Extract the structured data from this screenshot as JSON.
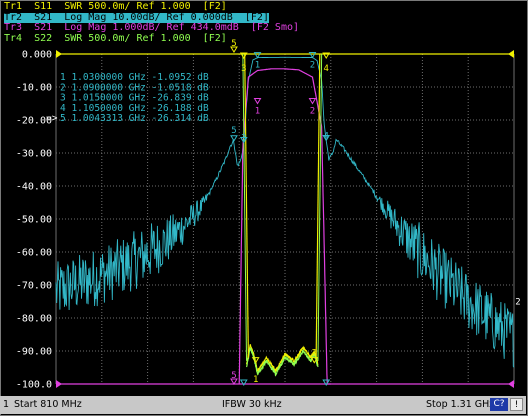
{
  "traces": [
    {
      "text": "Tr1  S11  SWR 500.0m/ Ref 1.000  [F2]",
      "color": "#f0f000",
      "active": false
    },
    {
      "text": "Tr2  S21  Log Mag 10.00dB/ Ref 0.000dB  [F2]",
      "color": "#32b8c8",
      "active": true
    },
    {
      "text": "Tr3  S21  Log Mag 1.000dB/ Ref 434.0mdB  [F2 Smo]",
      "color": "#e040e0",
      "active": false
    },
    {
      "text": "Tr4  S22  SWR 500.0m/ Ref 1.000  [F2]",
      "color": "#90ff50",
      "active": false
    }
  ],
  "markers": [
    {
      "num": "1",
      "freq": "1.0300000 GHz",
      "value": "-1.0952 dB",
      "active": false
    },
    {
      "num": "2",
      "freq": "1.0900000 GHz",
      "value": "-1.0518 dB",
      "active": false
    },
    {
      "num": "3",
      "freq": "1.0150000 GHz",
      "value": "-26.839  dB",
      "active": false
    },
    {
      "num": "4",
      "freq": "1.1050000 GHz",
      "value": "-26.188  dB",
      "active": false
    },
    {
      "num": "5",
      "freq": "1.0043313 GHz",
      "value": "-26.314  dB",
      "active": true
    }
  ],
  "ref_marker": "=>",
  "status": {
    "channel": "1",
    "start": "Start 810 MHz",
    "ifbw": "IFBW 30 kHz",
    "stop": "Stop 1.31 GHz",
    "c2": "C?",
    "q": "!"
  },
  "colors": {
    "tr1": "#f0f000",
    "tr2": "#32b8c8",
    "tr3": "#e040e0",
    "tr4": "#90ff50",
    "grid": "#6e6e6e",
    "axis_labels": "#ffffff"
  },
  "chart_data": {
    "type": "line",
    "title": "",
    "xlabel": "",
    "ylabel": "",
    "x_range_mhz": [
      810,
      1310
    ],
    "ylim": [
      -100,
      0
    ],
    "y_ticks": [
      0,
      -10,
      -20,
      -30,
      -40,
      -50,
      -60,
      -70,
      -80,
      -90,
      -100
    ],
    "y_tick_labels": [
      "0.000",
      "-10.00",
      "-20.00",
      "-30.00",
      "-40.00",
      "-50.00",
      "-60.00",
      "-70.00",
      "-80.00",
      "-90.00",
      "-100.0"
    ],
    "grid": true,
    "series": [
      {
        "name": "Tr2 S21 Log Mag",
        "color": "#32b8c8",
        "x": [
          810,
          840,
          870,
          900,
          930,
          950,
          970,
          985,
          995,
          1000,
          1004,
          1008,
          1012,
          1015,
          1020,
          1025,
          1030,
          1040,
          1060,
          1080,
          1090,
          1095,
          1100,
          1103,
          1105,
          1108,
          1112,
          1116,
          1125,
          1140,
          1160,
          1180,
          1200,
          1230,
          1260,
          1290,
          1310
        ],
        "y": [
          -72,
          -69,
          -66,
          -62,
          -57,
          -52,
          -46,
          -38,
          -32,
          -28,
          -26.3,
          -34,
          -32,
          -26.8,
          -8,
          -1.8,
          -1.1,
          -1.05,
          -1.0,
          -1.05,
          -1.05,
          -2,
          -8,
          -22,
          -26.2,
          -32,
          -30,
          -26,
          -29,
          -35,
          -43,
          -51,
          -58,
          -67,
          -75,
          -82,
          -86
        ]
      },
      {
        "name": "Tr3 S21 Log Mag 1dB/",
        "color": "#e040e0",
        "x": [
          1010,
          1014,
          1020,
          1030,
          1045,
          1060,
          1075,
          1090,
          1100,
          1106,
          1110
        ],
        "y": [
          -100,
          -28,
          -7,
          -5,
          -4.5,
          -4.5,
          -4.8,
          -7,
          -22,
          -100,
          -100
        ]
      },
      {
        "name": "Tr1 S11 SWR",
        "color": "#f0f000",
        "x": [
          1018,
          1022,
          1026,
          1030,
          1040,
          1050,
          1060,
          1070,
          1080,
          1088,
          1092,
          1096
        ],
        "y": [
          -94,
          -88,
          -91,
          -96,
          -92,
          -96,
          -91,
          -93,
          -89,
          -92,
          -90,
          -94
        ]
      },
      {
        "name": "Tr4 S22 SWR",
        "color": "#90ff50",
        "x": [
          1018,
          1022,
          1026,
          1030,
          1040,
          1050,
          1060,
          1070,
          1080,
          1088,
          1092,
          1096
        ],
        "y": [
          -95,
          -89,
          -92,
          -97,
          -93,
          -97,
          -92,
          -94,
          -90,
          -93,
          -91,
          -95
        ]
      }
    ]
  }
}
